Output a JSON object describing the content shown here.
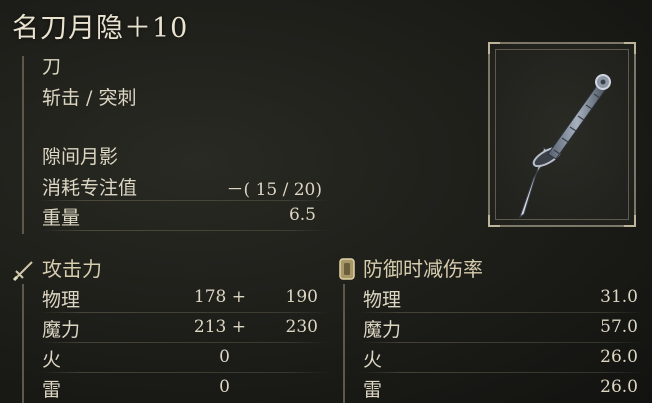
{
  "item": {
    "name": "名刀月隐＋10",
    "weapon_type": "刀",
    "attack_type": "斩击 / 突刺",
    "skill_name": "隙间月影",
    "fp_cost_label": "消耗专注值",
    "fp_cost_value": "－(  15 /  20)",
    "weight_label": "重量",
    "weight_value": "6.5",
    "icon": "katana-moonveil-icon"
  },
  "attack": {
    "title": "攻击力",
    "icon": "sword-icon",
    "rows": [
      {
        "label": "物理",
        "base": "178 +",
        "total": "190"
      },
      {
        "label": "魔力",
        "base": "213 +",
        "total": "230"
      },
      {
        "label": "火",
        "base": "0",
        "total": ""
      },
      {
        "label": "雷",
        "base": "0",
        "total": ""
      }
    ]
  },
  "guard": {
    "title": "防御时减伤率",
    "icon": "shield-icon",
    "rows": [
      {
        "label": "物理",
        "value": "31.0"
      },
      {
        "label": "魔力",
        "value": "57.0"
      },
      {
        "label": "火",
        "value": "26.0"
      },
      {
        "label": "雷",
        "value": "26.0"
      }
    ]
  }
}
